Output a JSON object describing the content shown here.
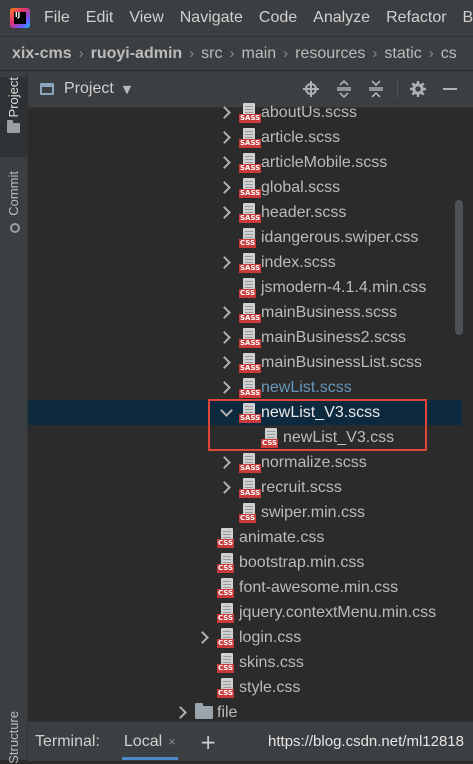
{
  "menubar": {
    "logo_text": "IJ",
    "items": [
      "File",
      "Edit",
      "View",
      "Navigate",
      "Code",
      "Analyze",
      "Refactor",
      "B"
    ]
  },
  "breadcrumb": [
    "xix-cms",
    "ruoyi-admin",
    "src",
    "main",
    "resources",
    "static",
    "cs"
  ],
  "left_strip": {
    "project_tab": "Project",
    "commit_tab": "Commit",
    "structure_tab": "Structure"
  },
  "panel": {
    "title": "Project",
    "dropdown_icon": "triangle-down-icon",
    "tools": [
      "locate-icon",
      "expand-all-icon",
      "collapse-all-icon",
      "gear-icon",
      "minimize-icon"
    ]
  },
  "tree": [
    {
      "name": "aboutUs.scss",
      "type": "scss",
      "expandable": true,
      "depth": 1
    },
    {
      "name": "article.scss",
      "type": "scss",
      "expandable": true,
      "depth": 1
    },
    {
      "name": "articleMobile.scss",
      "type": "scss",
      "expandable": true,
      "depth": 1
    },
    {
      "name": "global.scss",
      "type": "scss",
      "expandable": true,
      "depth": 1
    },
    {
      "name": "header.scss",
      "type": "scss",
      "expandable": true,
      "depth": 1
    },
    {
      "name": "idangerous.swiper.css",
      "type": "css-in-scss",
      "expandable": false,
      "depth": 1
    },
    {
      "name": "index.scss",
      "type": "scss",
      "expandable": true,
      "depth": 1
    },
    {
      "name": "jsmodern-4.1.4.min.css",
      "type": "css-in-scss",
      "expandable": false,
      "depth": 1
    },
    {
      "name": "mainBusiness.scss",
      "type": "scss",
      "expandable": true,
      "depth": 1
    },
    {
      "name": "mainBusiness2.scss",
      "type": "scss",
      "expandable": true,
      "depth": 1
    },
    {
      "name": "mainBusinessList.scss",
      "type": "scss",
      "expandable": true,
      "depth": 1
    },
    {
      "name": "newList.scss",
      "type": "scss",
      "expandable": true,
      "depth": 1,
      "modified": true
    },
    {
      "name": "newList_V3.scss",
      "type": "scss",
      "expandable": true,
      "expanded": true,
      "depth": 1,
      "selected": true
    },
    {
      "name": "newList_V3.css",
      "type": "css",
      "expandable": false,
      "depth": 2
    },
    {
      "name": "normalize.scss",
      "type": "scss",
      "expandable": true,
      "depth": 1
    },
    {
      "name": "recruit.scss",
      "type": "scss",
      "expandable": true,
      "depth": 1
    },
    {
      "name": "swiper.min.css",
      "type": "css-in-scss",
      "expandable": false,
      "depth": 1
    },
    {
      "name": "animate.css",
      "type": "css",
      "expandable": false,
      "depth": 0
    },
    {
      "name": "bootstrap.min.css",
      "type": "css",
      "expandable": false,
      "depth": 0
    },
    {
      "name": "font-awesome.min.css",
      "type": "css",
      "expandable": false,
      "depth": 0
    },
    {
      "name": "jquery.contextMenu.min.css",
      "type": "css",
      "expandable": false,
      "depth": 0
    },
    {
      "name": "login.css",
      "type": "css",
      "expandable": true,
      "depth": 0
    },
    {
      "name": "skins.css",
      "type": "css",
      "expandable": false,
      "depth": 0
    },
    {
      "name": "style.css",
      "type": "css",
      "expandable": false,
      "depth": 0
    },
    {
      "name": "file",
      "type": "folder",
      "expandable": true,
      "depth": -1
    }
  ],
  "file_badges": {
    "scss": "SASS",
    "css": "CSS"
  },
  "colors": {
    "selection": "#0d293e",
    "modified_text": "#6897bb",
    "highlight_box": "#e0453a",
    "badge_red": "#c93a3a"
  },
  "bottom_bar": {
    "terminal_label": "Terminal:",
    "local_tab": "Local",
    "close_glyph": "×",
    "add_glyph": "+",
    "watermark": "https://blog.csdn.net/ml12818"
  }
}
